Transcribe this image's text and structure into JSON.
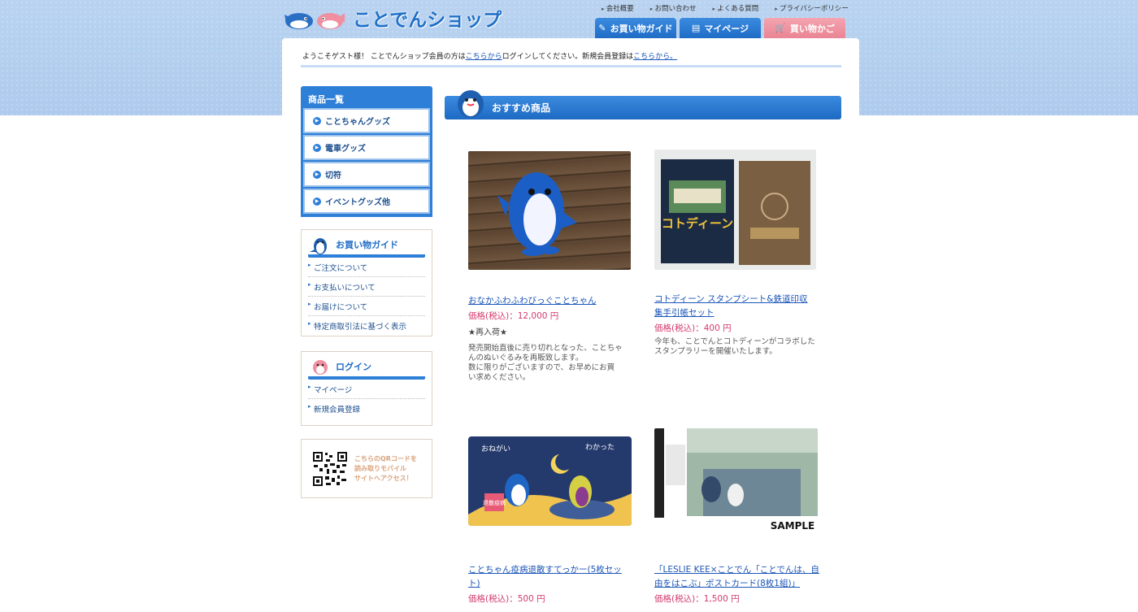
{
  "header": {
    "logo_text": "ことでんショップ",
    "util_links": [
      "会社概要",
      "お問い合わせ",
      "よくある質問",
      "プライバシーポリシー"
    ],
    "nav_tabs": [
      {
        "label": "お買い物ガイド",
        "icon": "book-icon"
      },
      {
        "label": "マイページ",
        "icon": "page-icon"
      },
      {
        "label": "買い物かご",
        "icon": "cart-icon"
      }
    ]
  },
  "welcome": {
    "prefix": "ようこそゲスト様！ ことでんショップ会員の方は",
    "login_link": "こちらから",
    "middle": "ログインしてください。新規会員登録は",
    "register_link": "こちらから。"
  },
  "sidebar": {
    "categories_title": "商品一覧",
    "categories": [
      "ことちゃんグッズ",
      "電車グッズ",
      "切符",
      "イベントグッズ他"
    ],
    "guide": {
      "title": "お買い物ガイド",
      "links": [
        "ご注文について",
        "お支払いについて",
        "お届けについて",
        "特定商取引法に基づく表示"
      ]
    },
    "login": {
      "title": "ログイン",
      "links": [
        "マイページ",
        "新規会員登録"
      ]
    },
    "qr": {
      "lines": [
        "こちらのQRコードを",
        "読み取りモバイル",
        "サイトへアクセス！"
      ]
    }
  },
  "main": {
    "section_title": "おすすめ商品",
    "products": [
      {
        "name": "おなかふわふわびっぐことちゃん",
        "price_label": "価格(税込)：",
        "price": "12,000 円",
        "note": "★再入荷★",
        "desc": [
          "発売開始直後に売り切れとなった、ことちゃ",
          "んのぬいぐるみを再販致します。",
          "数に限りがございますので、お早めにお買",
          "い求めください。"
        ]
      },
      {
        "name_lines": [
          "コトディーン スタンプシート&鉄道印収",
          "集手引帳セット"
        ],
        "price_label": "価格(税込)：",
        "price": "400 円",
        "desc": [
          "今年も、ことでんとコトディーンがコラボした",
          "スタンプラリーを開催いたします。"
        ]
      },
      {
        "name_lines": [
          "ことちゃん疫病退散すてっかー(5枚セッ",
          "ト)"
        ],
        "price_label": "価格(税込)：",
        "price": "500 円",
        "img_text": {
          "left": "おねがい",
          "right": "わかった",
          "badge": "退散疫病"
        }
      },
      {
        "name_lines": [
          "「LESLIE KEE×ことでん「ことでんは、自",
          "由をはこぶ」ポストカード(8枚1組)」"
        ],
        "price_label": "価格(税込)：",
        "price": "1,500 円",
        "img_text": {
          "sample": "SAMPLE"
        }
      }
    ]
  }
}
